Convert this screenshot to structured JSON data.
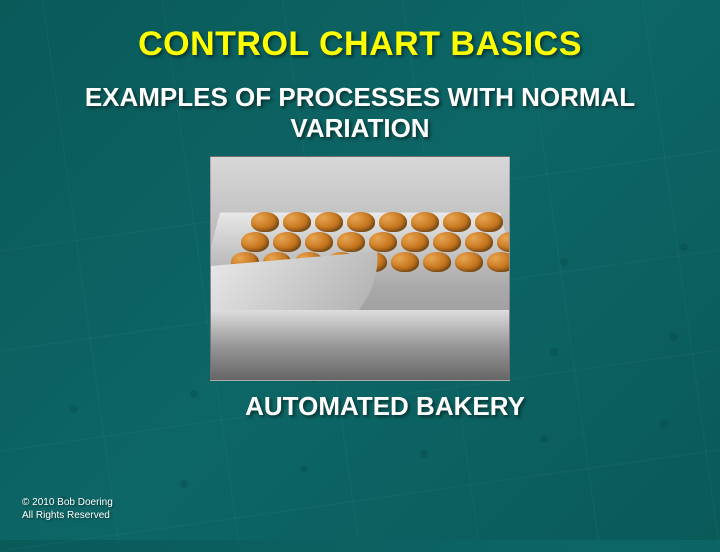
{
  "title": "CONTROL CHART BASICS",
  "subtitle": "EXAMPLES OF PROCESSES WITH NORMAL VARIATION",
  "caption": "AUTOMATED BAKERY",
  "copyright_line1": "© 2010  Bob Doering",
  "copyright_line2": "All Rights Reserved",
  "image_alt": "automated-bakery-conveyor"
}
